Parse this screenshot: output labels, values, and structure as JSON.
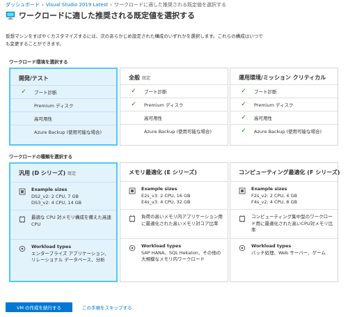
{
  "breadcrumb": {
    "items": [
      "ダッシュボード",
      "Visual Studio 2019 Latest",
      "ワークロードに適した推奨される既定値を選択する"
    ],
    "separator": "›"
  },
  "page": {
    "title": "ワークロードに適した推奨される既定値を選択する",
    "description": "仮想マシンをすばやくカスタマイズするには、次のあらかじめ設定された構成のいずれかを選択します。これらの構成はいつでも変更することができます。"
  },
  "environment": {
    "label": "ワークロード環境を選択する",
    "cards": [
      {
        "title": "開発/テスト",
        "tag": "",
        "selected": true,
        "features": [
          {
            "label": "ブート診断",
            "checked": true
          },
          {
            "label": "Premium ディスク",
            "checked": false
          },
          {
            "label": "高可用性",
            "checked": false
          },
          {
            "label": "Azure Backup (使用可能な場合)",
            "checked": false
          }
        ]
      },
      {
        "title": "全般",
        "tag": "既定",
        "selected": false,
        "features": [
          {
            "label": "ブート診断",
            "checked": true
          },
          {
            "label": "Premium ディスク",
            "checked": true
          },
          {
            "label": "高可用性",
            "checked": false
          },
          {
            "label": "Azure Backup (使用可能な場合)",
            "checked": false
          }
        ]
      },
      {
        "title": "運用環境/ミッション クリティカル",
        "tag": "",
        "selected": false,
        "features": [
          {
            "label": "ブート診断",
            "checked": true
          },
          {
            "label": "Premium ディスク",
            "checked": true
          },
          {
            "label": "高可用性",
            "checked": true
          },
          {
            "label": "Azure Backup (使用可能な場合)",
            "checked": true
          }
        ]
      }
    ]
  },
  "workload": {
    "label": "ワークロードの種類を選択する",
    "sizes_heading": "Example sizes",
    "types_heading": "Workload types",
    "cards": [
      {
        "title": "汎用 (D シリーズ)",
        "tag": "既定",
        "selected": true,
        "sizes": [
          "DS2_v2: 2 CPU, 7 GB",
          "DS3_v2: 4 CPU, 14 GB"
        ],
        "note": "最適な CPU 対メモリ構成を備えた高速 CPU",
        "types": "エンタープライズ アプリケーション、リレーショナル データベース、分析"
      },
      {
        "title": "メモリ最適化 (E シリーズ)",
        "tag": "",
        "selected": false,
        "sizes": [
          "E2s_v3: 2 CPU, 16 GB",
          "E4s_v3: 4 CPU, 32 GB"
        ],
        "note": "負荷の高いメモリ内アプリケーション用に最適化された高いメモリ対コア比率",
        "types": "SAP HANA、SQL Hekaton、その他の大規模なメモリ内ワークロード"
      },
      {
        "title": "コンピューティング最適化 (F シリーズ)",
        "tag": "",
        "selected": false,
        "sizes": [
          "F2s_v2: 2 CPU, 4 GB",
          "F4s_v2: 4 CPU, 8 GB"
        ],
        "note": "コンピューティング集中型のワークロード用に最適化された高いCPU対メモリ比率",
        "types": "バッチ処理、Web サーバー、ゲーム"
      }
    ]
  },
  "actions": {
    "primary": "VM の作成を続行する",
    "skip": "この手順をスキップする"
  },
  "colors": {
    "accent": "#0078d4",
    "selected_border": "#50c7f4",
    "selected_bg": "#e3f3fc",
    "check": "#107c10"
  }
}
